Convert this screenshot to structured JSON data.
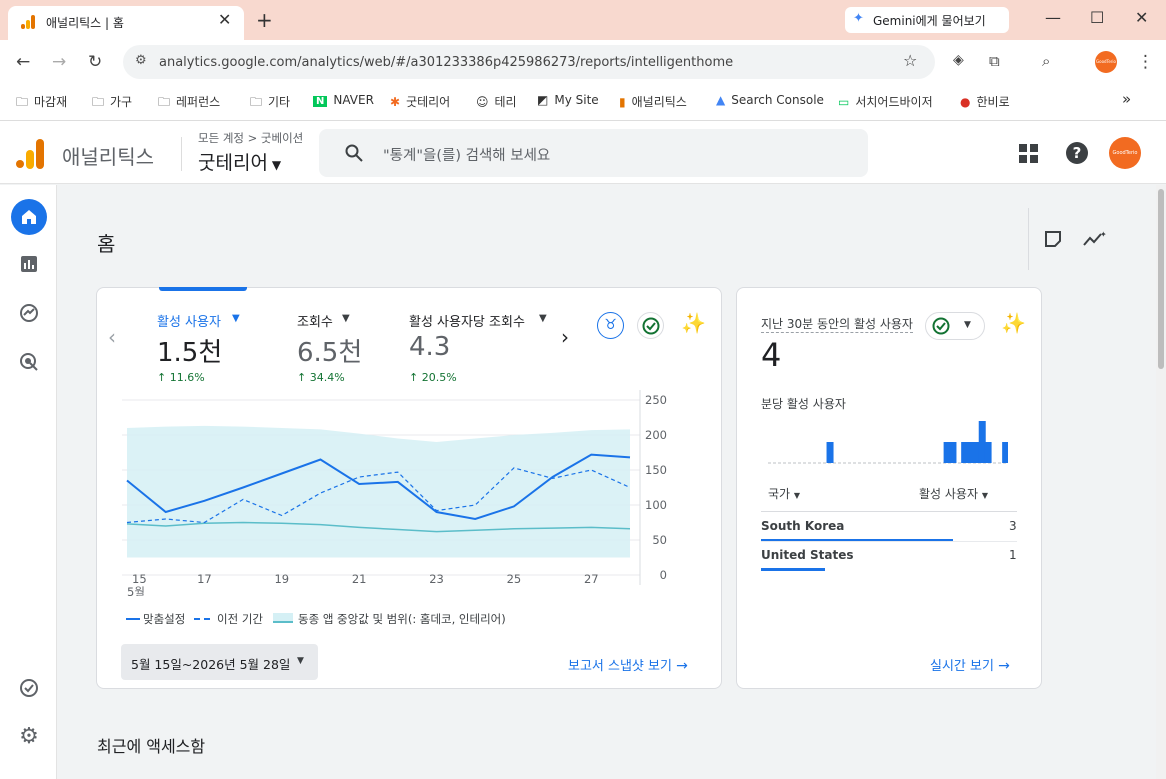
{
  "browser": {
    "tab_title": "애널리틱스 | 홈",
    "new_tab": "+",
    "gemini_button": "Gemini에게 물어보기",
    "url": "analytics.google.com/analytics/web/#/a301233386p425986273/reports/intelligenthome",
    "bookmarks": [
      {
        "label": "마감재",
        "icon": "folder-icon"
      },
      {
        "label": "가구",
        "icon": "folder-icon"
      },
      {
        "label": "레퍼런스",
        "icon": "folder-icon"
      },
      {
        "label": "기타",
        "icon": "folder-icon"
      },
      {
        "label": "NAVER",
        "icon": "naver-icon"
      },
      {
        "label": "굿테리어",
        "icon": "asterisk-icon"
      },
      {
        "label": "테리",
        "icon": "person-icon"
      },
      {
        "label": "My Site",
        "icon": "site-icon"
      },
      {
        "label": "애널리틱스",
        "icon": "analytics-icon"
      },
      {
        "label": "Search Console",
        "icon": "search-console-icon"
      },
      {
        "label": "서치어드바이저",
        "icon": "monitor-icon"
      },
      {
        "label": "한비로",
        "icon": "hanbiro-icon"
      }
    ],
    "more": "»"
  },
  "ga": {
    "brand": "애널리틱스",
    "account_crumb": "모든 계정 > 굿베이션",
    "property": "굿테리어",
    "search_placeholder": "\"통계\"을(를) 검색해 보세요",
    "avatar_text": "GoodTerio"
  },
  "home": {
    "title": "홈",
    "metrics": [
      {
        "label": "활성 사용자",
        "value": "1.5천",
        "delta": "11.6%",
        "selected": true
      },
      {
        "label": "조회수",
        "value": "6.5천",
        "delta": "34.4%",
        "selected": false
      },
      {
        "label": "활성 사용자당 조회수",
        "value": "4.3",
        "delta": "20.5%",
        "selected": false
      }
    ],
    "legend": {
      "current": "맞춤설정",
      "previous": "이전 기간",
      "benchmark": "동종 앱 중앙값 및 범위(: 홈데코, 인테리어)"
    },
    "date_range": "5월 15일~2026년 5월 28일",
    "snapshot_link": "보고서 스냅샷 보기",
    "colors": {
      "primary": "#1a73e8",
      "benchmark_fill": "#d5f0f5",
      "benchmark_line": "#5bbdc9",
      "positive": "#137333"
    }
  },
  "realtime": {
    "title": "지난 30분 동안의 활성 사용자",
    "value": "4",
    "per_minute_label": "분당 활성 사용자",
    "per_minute_bars": [
      0,
      0,
      0,
      0,
      0,
      0,
      0,
      0,
      0,
      0,
      1,
      0,
      0,
      0,
      0,
      0,
      0,
      0,
      0,
      0,
      0,
      0,
      0,
      0,
      0,
      0,
      0,
      0,
      0,
      0,
      1,
      1,
      0,
      1,
      1,
      1,
      2,
      1,
      0,
      0,
      1
    ],
    "col_country": "국가",
    "col_users": "활성 사용자",
    "rows": [
      {
        "country": "South Korea",
        "users": "3",
        "share": 0.75
      },
      {
        "country": "United States",
        "users": "1",
        "share": 0.25
      }
    ],
    "link": "실시간 보기"
  },
  "recent": {
    "title": "최근에 액세스함"
  },
  "chart_data": {
    "type": "line",
    "x": [
      "5/15",
      "5/16",
      "5/17",
      "5/18",
      "5/19",
      "5/20",
      "5/21",
      "5/22",
      "5/23",
      "5/24",
      "5/25",
      "5/26",
      "5/27",
      "5/28"
    ],
    "x_ticks": [
      "15",
      "17",
      "19",
      "21",
      "23",
      "25",
      "27"
    ],
    "x_month_label": "5월",
    "y_ticks": [
      "250",
      "200",
      "150",
      "100",
      "50",
      "0"
    ],
    "ylim": [
      0,
      250
    ],
    "y_axis_side": "right",
    "series": [
      {
        "name": "맞춤설정",
        "values": [
          135,
          90,
          106,
          125,
          145,
          165,
          130,
          133,
          90,
          80,
          98,
          140,
          172,
          168
        ]
      },
      {
        "name": "이전 기간",
        "values": [
          75,
          80,
          75,
          108,
          85,
          117,
          140,
          147,
          92,
          100,
          153,
          138,
          150,
          125
        ]
      },
      {
        "name": "동종 앱 중앙값 및 범위(: 홈데코, 인테리어)",
        "values": [
          73,
          70,
          74,
          75,
          74,
          72,
          68,
          65,
          62,
          64,
          66,
          67,
          68,
          66
        ],
        "range_low": [
          25,
          25,
          25,
          25,
          25,
          25,
          25,
          25,
          25,
          25,
          25,
          25,
          25,
          25
        ],
        "range_high": [
          210,
          212,
          213,
          212,
          210,
          208,
          202,
          195,
          190,
          195,
          200,
          203,
          207,
          208
        ]
      }
    ],
    "legend_position": "bottom",
    "grid": true
  }
}
